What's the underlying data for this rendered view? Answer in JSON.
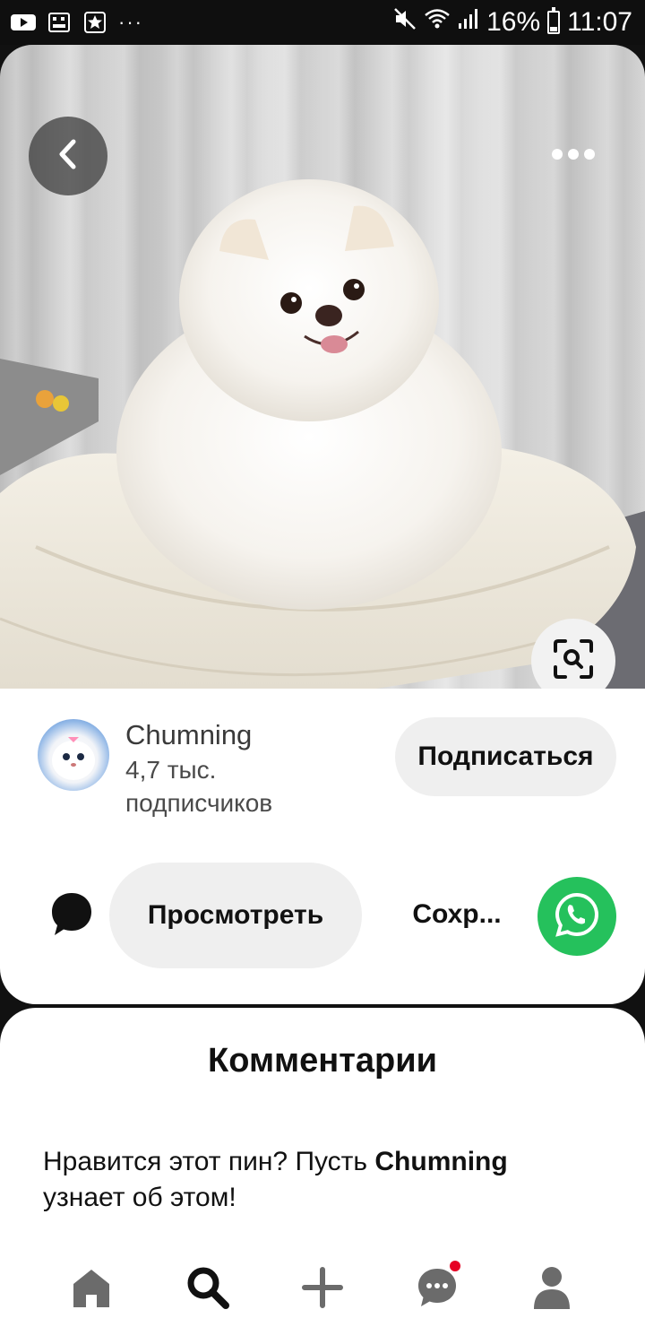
{
  "status_bar": {
    "battery": "16%",
    "time": "11:07",
    "overflow": "···",
    "icons": [
      "youtube-icon",
      "gallery-icon",
      "star-icon",
      "mute-icon",
      "wifi-icon",
      "signal-icon",
      "battery-icon"
    ]
  },
  "pin": {
    "image_alt": "white pomeranian dog on a cushion",
    "back_icon": "chevron-left-icon",
    "more_icon": "more-dots-icon",
    "lens_icon": "visual-search-icon"
  },
  "author": {
    "name": "Chumning",
    "followers": "4,7 тыс. подписчиков",
    "follow_label": "Подписаться"
  },
  "actions": {
    "comment_icon": "comment-icon",
    "view_label": "Просмотреть",
    "save_label": "Сохр...",
    "share_icon": "whatsapp-icon"
  },
  "comments": {
    "title": "Комментарии",
    "prompt_before": "Нравится этот пин? Пусть ",
    "prompt_author": "Chumning",
    "prompt_after": " узнает об этом!"
  },
  "nav": {
    "items": [
      "home-icon",
      "search-icon",
      "create-icon",
      "messages-icon",
      "profile-icon"
    ],
    "active": "search-icon",
    "badge_color": "#e60023"
  },
  "colors": {
    "accent_green": "#25c15c",
    "button_gray": "#efefef"
  }
}
